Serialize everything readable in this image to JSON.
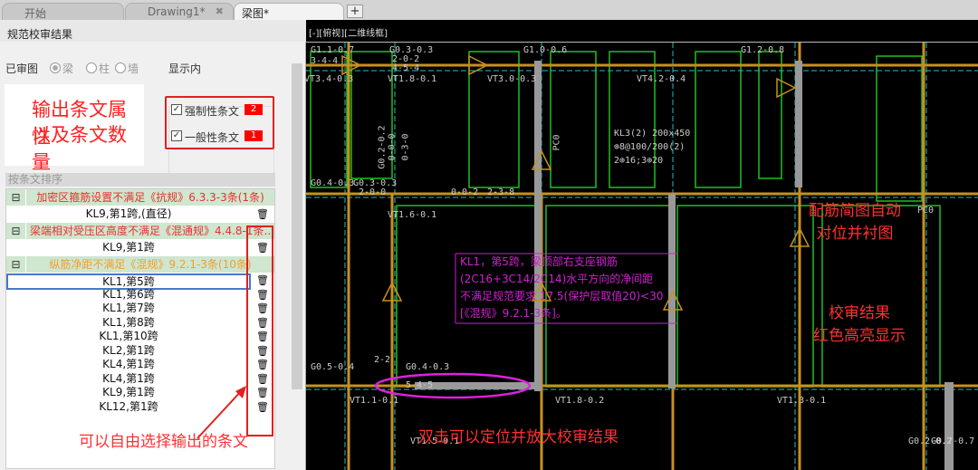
{
  "tabs": [
    {
      "label": "开始"
    },
    {
      "label": "Drawing1*",
      "close": "✖"
    },
    {
      "label": "梁图*"
    }
  ],
  "new_tab": "+",
  "panel": {
    "title": "规范校审结果",
    "reviewed_label": "已审图",
    "radios": [
      "梁",
      "柱",
      "墙"
    ],
    "show_label": "显示内",
    "callout1": [
      "输出条文属性",
      "以及条文数量"
    ],
    "checks": [
      {
        "label": "强制性条文",
        "count": "2"
      },
      {
        "label": "一般性条文",
        "count": "1"
      }
    ],
    "sort_label": "按条文排序",
    "groups": [
      {
        "title": "加密区箍筋设置不满足《抗规》6.3.3-3条(1条)",
        "color": "#e83030",
        "items": [
          "KL9,第1跨,(直径)"
        ]
      },
      {
        "title": "梁端相对受压区高度不满足《混通规》4.4.8-1条...",
        "color": "#e83030",
        "items": [
          "KL9,第1跨"
        ]
      },
      {
        "title": "纵筋净距不满足《混规》9.2.1-3条(10条)",
        "color": "#f0a030",
        "items": [
          "KL1,第5跨",
          "KL1,第6跨",
          "KL1,第7跨",
          "KL1,第8跨",
          "KL1,第10跨",
          "KL2,第1跨",
          "KL4,第1跨",
          "KL4,第1跨",
          "KL9,第1跨",
          "KL12,第1跨"
        ]
      }
    ],
    "callout2": "可以自由选择输出的条文"
  },
  "cad": {
    "view_label": "[-][俯视][二维线框]",
    "labels": [
      "G1.1-0.7",
      "G0.3-0.3",
      "2-0-2",
      "4-5-4",
      "G1.0-0.6",
      "G1.2-0.8",
      "3-4-4",
      "VT1.8-0.1",
      "VT3.0-0.3",
      "VT4.2-0.4",
      "VT3.4-0.3",
      "G0.2-0.2",
      "0-0-0",
      "0-3-0",
      "PC0",
      "G0.4-0.3",
      "G0.3-0.3",
      "2-0-0",
      "0-0-2",
      "2-3-8",
      "VT1.6-0.1",
      "VT1.1-0.1",
      "G0.5-0.4",
      "G0.4-0.3",
      "5-4-5",
      "VT1.8-0.2",
      "VT1.3-0.1",
      "VT1.5-0.1",
      "2-2",
      "KL3(2) 200x450",
      "⊕8@100/200(2)",
      "2⊕16;3⊕20",
      "PC0",
      "G0.2-0.2",
      "G0.7-0.7"
    ],
    "message": [
      "KL1，第5跨，梁顶部右支座钢筋",
      "(2C16+3C14/2C14)水平方向的净间距",
      "不满足规范要求  17.5(保护层取值20)<30",
      "[《混规》9.2.1-3条]。"
    ],
    "callout_auto": [
      "配筋简图自动",
      "对位并衬图"
    ],
    "callout_red": [
      "校审结果",
      "红色高亮显示"
    ],
    "callout_dbl": "双击可以定位并放大校审结果"
  },
  "colors": {
    "beam": "#c89020",
    "wall": "#20c020",
    "axis": "#20c0c0",
    "highlight": "#e020e0",
    "note": "#ff3030"
  }
}
